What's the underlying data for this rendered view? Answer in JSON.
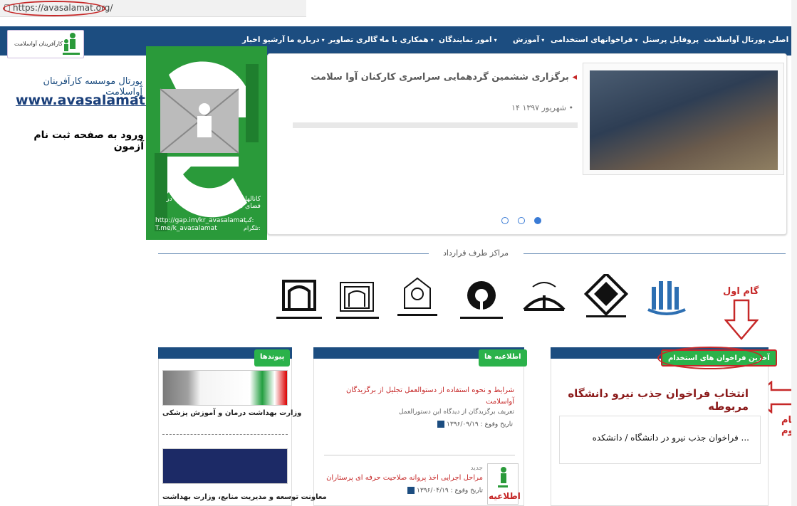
{
  "browser": {
    "url": "https://avasalamat.org/"
  },
  "logo": {
    "text": "کارآفرینان آواسلامت"
  },
  "nav": {
    "items": [
      {
        "label": "صفحه اصلی پورتال آواسلامت",
        "dropdown": false
      },
      {
        "label": "پروفایل پرسنل",
        "dropdown": false
      },
      {
        "label": "فراخوانهای استخدامی",
        "dropdown": true
      },
      {
        "label": "آموزش",
        "dropdown": true
      },
      {
        "label": "امور نمایندگان",
        "dropdown": true
      },
      {
        "label": "همکاری با ما",
        "dropdown": true
      },
      {
        "label": "گالری تصاویر",
        "dropdown": true
      },
      {
        "label": "درباره ما",
        "dropdown": true
      },
      {
        "label": "آرشیو اخبار",
        "dropdown": false
      }
    ]
  },
  "sidebar": {
    "portal_title": "پورتال موسسه کارآفرینان آواسلامت",
    "site_url": "www.avasalamat.org",
    "exam_link": "ورود به صفحه ثبت نام آزمون"
  },
  "banner": {
    "message": "کانالهای اطلاع رسانی آوا سلامت در فضای مجازی",
    "gap_url": "http://gap.im/kr_avasalamat",
    "gap_label": "گپ:",
    "tme_url": "T.me/k_avasalamat",
    "tme_label": "تلگرام:"
  },
  "slider": {
    "title": "برگزاری ششمین گردهمایی سراسری کارکنان آوا سلامت",
    "date": "۱۴ شهریور ۱۳۹۷",
    "dots": 3,
    "active_dot": 3
  },
  "contracts": {
    "heading": "مراکز طرف قرارداد"
  },
  "annotations": {
    "step1": "گام اول",
    "step2": "گام دوم",
    "select_notice": "انتخاب فراخوان جذب نیرو دانشگاه مربوطه"
  },
  "jobs_panel": {
    "tab": "آخرین فراخوان های استخدام",
    "item": "فراخوان جذب نیرو در دانشگاه / دانشکده ..."
  },
  "news_panel": {
    "tab": "اطلاعیه ها",
    "items": [
      {
        "title": "شرایط و نحوه استفاده از دستوالعمل تجلیل از برگزیدگان آواسلامت",
        "summary": "تعریف برگزیدگان از دیدگاه این دستورالعمل",
        "date_label": "تاریخ وقوع :",
        "date": "۱۳۹۶/۰۹/۱۹"
      },
      {
        "badge": "جدید",
        "title": "مراحل اجرایی اخذ پروانه صلاحیت حرفه ای پرستاران",
        "date_label": "تاریخ وقوع :",
        "date": "۱۳۹۶/۰۴/۱۹",
        "thumb": "اطلاعیه"
      }
    ]
  },
  "links_panel": {
    "tab": "پیوندها",
    "items": [
      {
        "label": "وزارت بهداشت درمان و آموزش پزشکی"
      },
      {
        "label": "معاونت توسعه و مدیریت منابع، وزارت بهداشت"
      }
    ]
  },
  "colors": {
    "nav": "#1c4d80",
    "green": "#2bb24a",
    "annotation": "#c62828"
  }
}
